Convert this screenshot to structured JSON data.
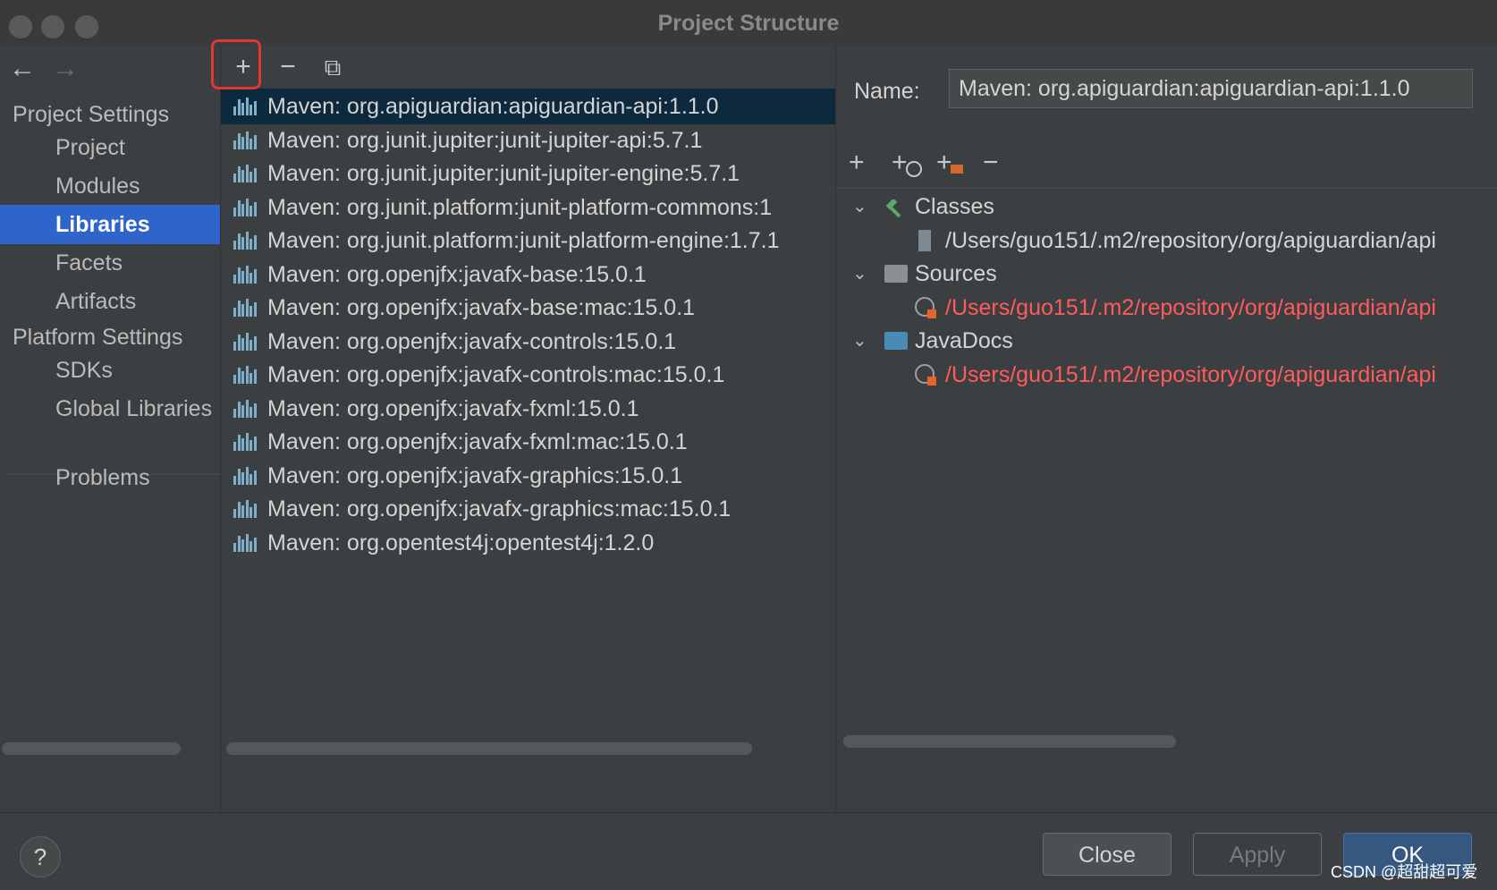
{
  "window": {
    "title": "Project Structure"
  },
  "left_panel": {
    "back_icon": "arrow-left-icon",
    "forward_icon": "arrow-right-icon",
    "groups": [
      {
        "label": "Project Settings",
        "items": [
          "Project",
          "Modules",
          "Libraries",
          "Facets",
          "Artifacts"
        ]
      },
      {
        "label": "Platform Settings",
        "items": [
          "SDKs",
          "Global Libraries"
        ]
      }
    ],
    "problems": "Problems",
    "selected": "Libraries"
  },
  "middle_panel": {
    "toolbar": {
      "add": "+",
      "remove": "−",
      "copy": "⧉"
    },
    "libraries": [
      "Maven: org.apiguardian:apiguardian-api:1.1.0",
      "Maven: org.junit.jupiter:junit-jupiter-api:5.7.1",
      "Maven: org.junit.jupiter:junit-jupiter-engine:5.7.1",
      "Maven: org.junit.platform:junit-platform-commons:1",
      "Maven: org.junit.platform:junit-platform-engine:1.7.1",
      "Maven: org.openjfx:javafx-base:15.0.1",
      "Maven: org.openjfx:javafx-base:mac:15.0.1",
      "Maven: org.openjfx:javafx-controls:15.0.1",
      "Maven: org.openjfx:javafx-controls:mac:15.0.1",
      "Maven: org.openjfx:javafx-fxml:15.0.1",
      "Maven: org.openjfx:javafx-fxml:mac:15.0.1",
      "Maven: org.openjfx:javafx-graphics:15.0.1",
      "Maven: org.openjfx:javafx-graphics:mac:15.0.1",
      "Maven: org.opentest4j:opentest4j:1.2.0"
    ],
    "selected_index": 0
  },
  "right_panel": {
    "name_label": "Name:",
    "name_value": "Maven: org.apiguardian:apiguardian-api:1.1.0",
    "toolbar": {
      "add": "+",
      "add_url": "+",
      "attach": "+",
      "remove": "−"
    },
    "tree": {
      "classes_label": "Classes",
      "classes_path": "/Users/guo151/.m2/repository/org/apiguardian/api",
      "sources_label": "Sources",
      "sources_path": "/Users/guo151/.m2/repository/org/apiguardian/api",
      "javadocs_label": "JavaDocs",
      "javadocs_path": "/Users/guo151/.m2/repository/org/apiguardian/api"
    },
    "invalid_path_color": "#ff5b5b"
  },
  "bottom_bar": {
    "help": "?",
    "close": "Close",
    "apply": "Apply",
    "ok": "OK",
    "watermark": "CSDN @超甜超可爱"
  },
  "colors": {
    "selection": "#2f65ca",
    "list_selection": "#0d293e",
    "highlight_box": "#e0392b"
  }
}
